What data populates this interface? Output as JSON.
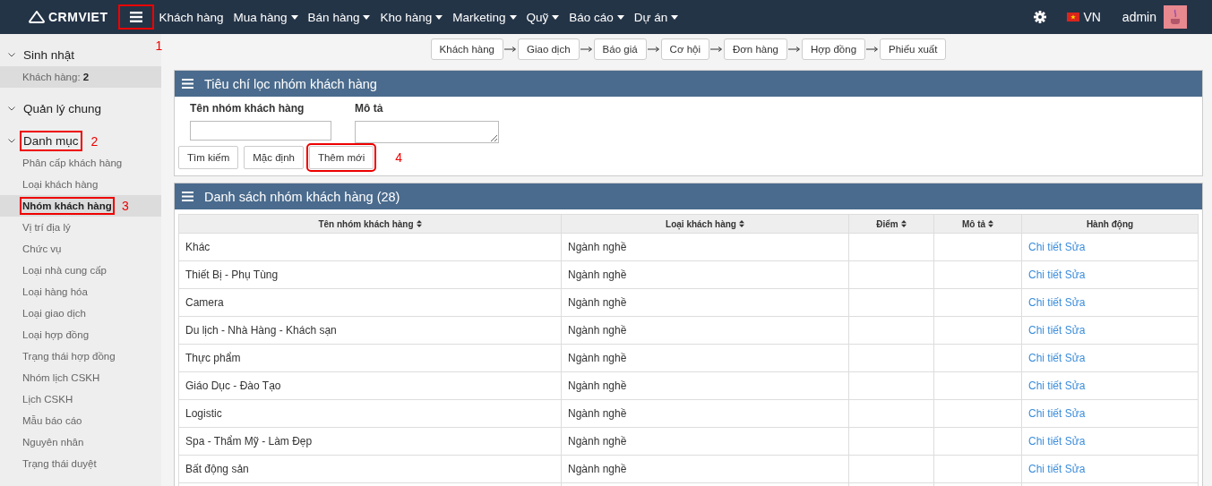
{
  "topbar": {
    "logo": "CRMVIET",
    "menu_callout": "1",
    "nav": [
      {
        "label": "Khách hàng",
        "dropdown": false
      },
      {
        "label": "Mua hàng",
        "dropdown": true
      },
      {
        "label": "Bán hàng",
        "dropdown": true
      },
      {
        "label": "Kho hàng",
        "dropdown": true
      },
      {
        "label": "Marketing",
        "dropdown": true
      },
      {
        "label": "Quỹ",
        "dropdown": true
      },
      {
        "label": "Báo cáo",
        "dropdown": true
      },
      {
        "label": "Dự án",
        "dropdown": true
      }
    ],
    "language": "VN",
    "user": "admin"
  },
  "sidebar": [
    {
      "title": "Sinh nhật",
      "items": [
        {
          "label": "Khách hàng: **2**",
          "selected": false,
          "kind": "stat"
        }
      ]
    },
    {
      "title": "Quản lý chung"
    },
    {
      "title": "Danh mục",
      "callout": "2",
      "items": [
        {
          "label": "Phân cấp khách hàng",
          "selected": false
        },
        {
          "label": "Loại khách hàng",
          "selected": false
        },
        {
          "label": "Nhóm khách hàng",
          "selected": true,
          "callout": "3"
        },
        {
          "label": "Vị trí địa lý",
          "selected": false
        },
        {
          "label": "Chức vụ",
          "selected": false
        },
        {
          "label": "Loại nhà cung cấp",
          "selected": false
        },
        {
          "label": "Loại hàng hóa",
          "selected": false
        },
        {
          "label": "Loại giao dịch",
          "selected": false
        },
        {
          "label": "Loại hợp đồng",
          "selected": false
        },
        {
          "label": "Trạng thái hợp đồng",
          "selected": false
        },
        {
          "label": "Nhóm lịch CSKH",
          "selected": false
        },
        {
          "label": "Lịch CSKH",
          "selected": false
        },
        {
          "label": "Mẫu báo cáo",
          "selected": false
        },
        {
          "label": "Nguyên nhân",
          "selected": false
        },
        {
          "label": "Trạng thái duyệt",
          "selected": false
        }
      ]
    }
  ],
  "workflow": [
    "Khách hàng",
    "Giao dịch",
    "Báo giá",
    "Cơ hội",
    "Đơn hàng",
    "Hợp đồng",
    "Phiếu xuất"
  ],
  "filter_panel": {
    "title": "Tiêu chí lọc nhóm khách hàng",
    "fields": [
      {
        "label": "Tên nhóm khách hàng",
        "kind": "input"
      },
      {
        "label": "Mô tả",
        "kind": "textarea"
      }
    ],
    "buttons": [
      {
        "label": "Tìm kiếm"
      },
      {
        "label": "Mặc định"
      },
      {
        "label": "Thêm mới",
        "callout": "4"
      }
    ]
  },
  "list_panel": {
    "title": "Danh sách nhóm khách hàng (28)",
    "columns": [
      "Tên nhóm khách hàng",
      "Loại khách hàng",
      "Điểm",
      "Mô tả",
      "Hành động"
    ],
    "rows": [
      {
        "name": "Khác",
        "type": "Ngành nghề",
        "actions": [
          "Chi tiết",
          "Sửa"
        ]
      },
      {
        "name": "Thiết Bị - Phụ Tùng",
        "type": "Ngành nghề",
        "actions": [
          "Chi tiết",
          "Sửa"
        ]
      },
      {
        "name": "Camera",
        "type": "Ngành nghề",
        "actions": [
          "Chi tiết",
          "Sửa"
        ]
      },
      {
        "name": "Du lịch - Nhà Hàng - Khách sạn",
        "type": "Ngành nghề",
        "actions": [
          "Chi tiết",
          "Sửa"
        ]
      },
      {
        "name": "Thực phẩm",
        "type": "Ngành nghề",
        "actions": [
          "Chi tiết",
          "Sửa"
        ]
      },
      {
        "name": "Giáo Dục - Đào Tạo",
        "type": "Ngành nghề",
        "actions": [
          "Chi tiết",
          "Sửa"
        ]
      },
      {
        "name": "Logistic",
        "type": "Ngành nghề",
        "actions": [
          "Chi tiết",
          "Sửa"
        ]
      },
      {
        "name": "Spa - Thẩm Mỹ - Làm Đẹp",
        "type": "Ngành nghề",
        "actions": [
          "Chi tiết",
          "Sửa"
        ]
      },
      {
        "name": "Bất động sản",
        "type": "Ngành nghề",
        "actions": [
          "Chi tiết",
          "Sửa"
        ]
      }
    ]
  }
}
